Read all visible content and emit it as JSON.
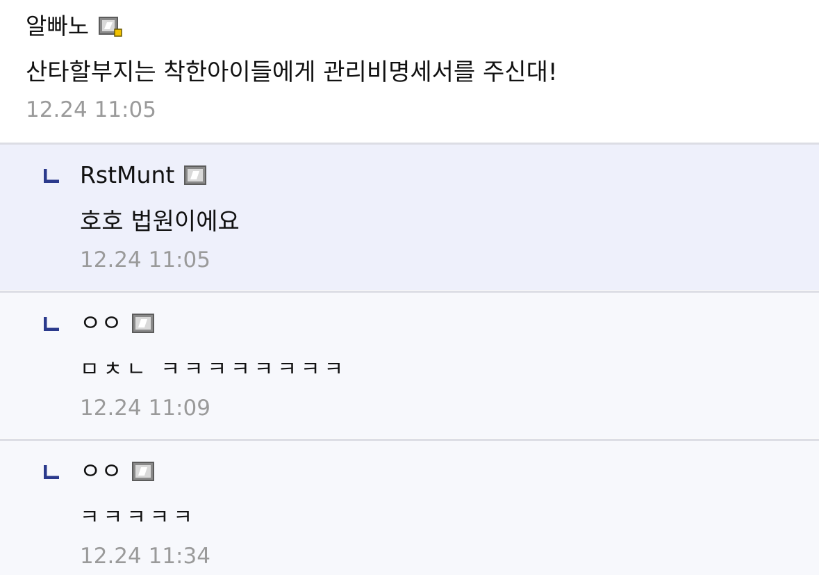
{
  "post": {
    "author": "알빠노",
    "author_badge": "gallery-manager-badge-icon",
    "body": "산타할부지는 착한아이들에게 관리비명세서를 주신대!",
    "time": "12.24 11:05"
  },
  "replies": [
    {
      "author": "RstMunt",
      "author_badge": "fixed-nick-badge-icon",
      "body": "호호 법원이에요",
      "time": "12.24 11:05"
    },
    {
      "author": "ㅇㅇ",
      "author_badge": "fixed-nick-badge-icon",
      "body": "ㅁㅊㄴ ㅋㅋㅋㅋㅋㅋㅋㅋ",
      "time": "12.24 11:09"
    },
    {
      "author": "ㅇㅇ",
      "author_badge": "fixed-nick-badge-icon",
      "body": "ㅋㅋㅋㅋㅋ",
      "time": "12.24 11:34"
    }
  ],
  "colors": {
    "reply_arrow": "#2b3a8c",
    "timestamp": "#9a9a9a",
    "highlight_bg": "#eef0fb",
    "reply_bg": "#f7f8fc"
  }
}
